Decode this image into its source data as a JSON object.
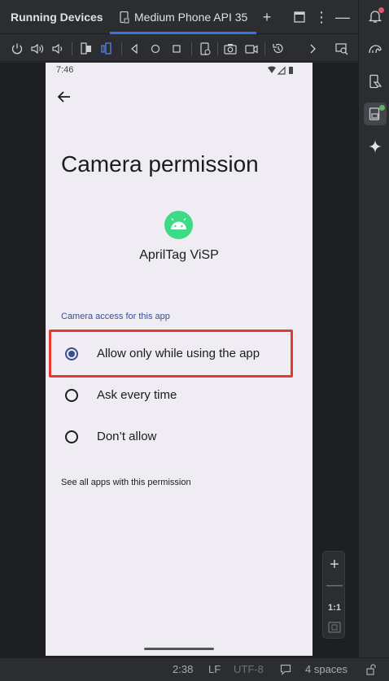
{
  "window": {
    "tool_window_title": "Running Devices",
    "tab_label": "Medium Phone API 35"
  },
  "device_screen": {
    "status_time": "7:46",
    "title": "Camera permission",
    "app_name": "AprilTag ViSP",
    "section_label": "Camera access for this app",
    "options": [
      {
        "label": "Allow only while using the app",
        "selected": true
      },
      {
        "label": "Ask every time",
        "selected": false
      },
      {
        "label": "Don’t allow",
        "selected": false
      }
    ],
    "see_all_link": "See all apps with this permission"
  },
  "zoom": {
    "zoom_in": "+",
    "zoom_out": "—",
    "actual_size": "1:1"
  },
  "statusbar": {
    "position": "2:38",
    "line_separator": "LF",
    "encoding": "UTF-8",
    "indent": "4 spaces"
  },
  "colors": {
    "accent": "#3574f0",
    "highlight_box": "#e63a2e",
    "android_green": "#3ddc84",
    "notification_badge": "#e55765",
    "status_ok": "#5fb865"
  }
}
